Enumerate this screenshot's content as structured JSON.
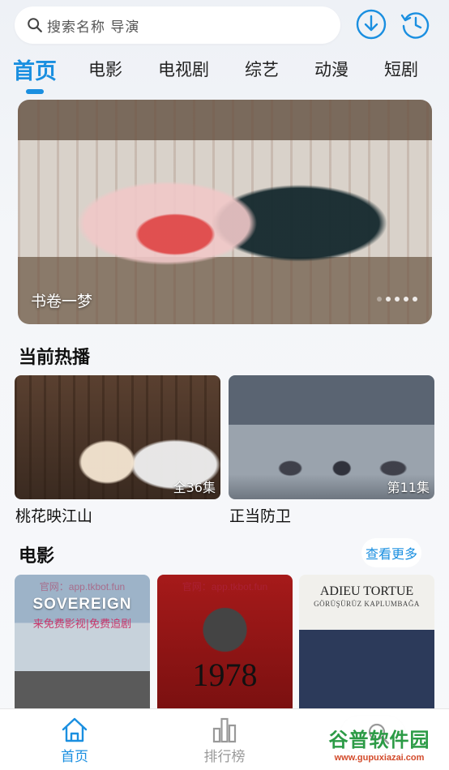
{
  "colors": {
    "accent": "#1a8fe0",
    "background": "#f4f6f9",
    "inactive": "#999999"
  },
  "search": {
    "placeholder": "搜索名称 导演",
    "icon": "search-icon"
  },
  "toolbar": {
    "download_icon": "download-icon",
    "history_icon": "history-icon"
  },
  "tabs": [
    {
      "label": "首页",
      "active": true
    },
    {
      "label": "电影",
      "active": false
    },
    {
      "label": "电视剧",
      "active": false
    },
    {
      "label": "综艺",
      "active": false
    },
    {
      "label": "动漫",
      "active": false
    },
    {
      "label": "短剧",
      "active": false
    }
  ],
  "banner": {
    "title": "书卷一梦",
    "dot_count": 5,
    "active_dot": 0
  },
  "hot": {
    "title": "当前热播",
    "items": [
      {
        "name": "桃花映江山",
        "badge": "全36集"
      },
      {
        "name": "正当防卫",
        "badge": "第11集"
      }
    ]
  },
  "movies": {
    "title": "电影",
    "more_label": "查看更多",
    "posters": [
      {
        "title": "SOVEREIGN",
        "subtitle": "来免费影视|免费追剧",
        "watermark": "官网：app.tkbot.fun"
      },
      {
        "title": "1978",
        "watermark": "官网：app.tkbot.fun"
      },
      {
        "title": "ADIEU TORTUE",
        "subtitle": "GÖRÜŞÜRÜZ KAPLUMBAĞA"
      }
    ]
  },
  "bottom_nav": [
    {
      "label": "首页",
      "icon": "home-icon",
      "active": true
    },
    {
      "label": "排行榜",
      "icon": "bar-chart-icon",
      "active": false
    },
    {
      "label": "",
      "icon": "search-icon",
      "active": false
    }
  ],
  "watermark": {
    "brand": "谷普软件园",
    "url": "www.gupuxiazai.com"
  }
}
